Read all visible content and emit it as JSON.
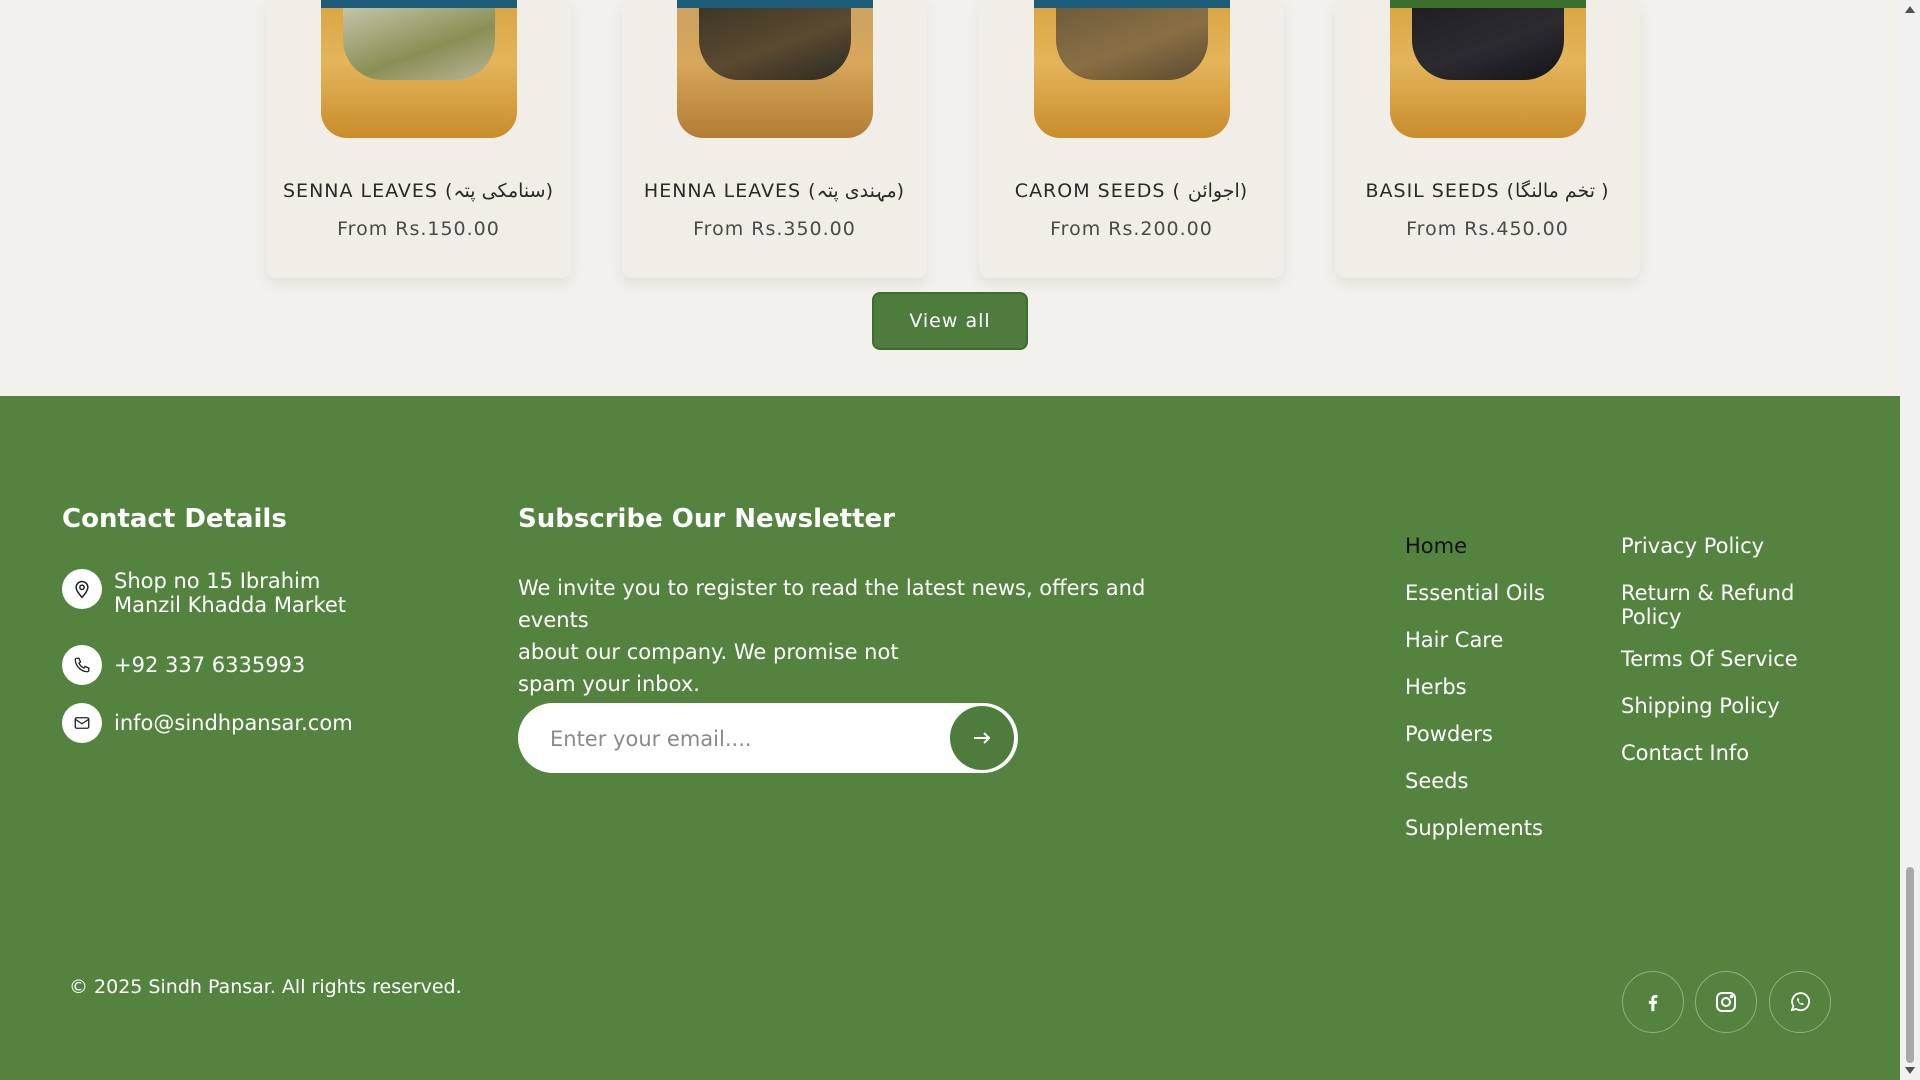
{
  "products": [
    {
      "title": "SENNA LEAVES (سنامکی پتہ)",
      "price": "From Rs.150.00"
    },
    {
      "title": "HENNA LEAVES (مہندی پتہ)",
      "price": "From Rs.350.00"
    },
    {
      "title": "CAROM SEEDS ( اجوائن)",
      "price": "From Rs.200.00"
    },
    {
      "title": "BASIL SEEDS (تخم مالنگا )",
      "price": "From Rs.450.00"
    }
  ],
  "view_all_label": "View all",
  "contact": {
    "heading": "Contact Details",
    "address_line1": "Shop no 15 Ibrahim",
    "address_line2": "Manzil Khadda Market",
    "phone": "+92 337 6335993",
    "email": "info@sindhpansar.com"
  },
  "newsletter": {
    "heading": "Subscribe Our Newsletter",
    "text_line1": "We invite you to register to read the latest news, offers and events",
    "text_line2": "about our company. We promise not",
    "text_line3": "spam your inbox.",
    "placeholder": "Enter your email...."
  },
  "nav_links": [
    "Home",
    "Essential Oils",
    "Hair Care",
    "Herbs",
    "Powders",
    "Seeds",
    "Supplements"
  ],
  "policy_links": [
    "Privacy Policy",
    "Return & Refund Policy",
    "Terms Of Service",
    "Shipping Policy",
    "Contact Info"
  ],
  "copyright": "© 2025 Sindh Pansar. All rights reserved.",
  "social": [
    "facebook-icon",
    "instagram-icon",
    "whatsapp-icon"
  ],
  "colors": {
    "footer_bg": "#54833f",
    "button_bg": "#4e7c3d",
    "page_bg": "#f2f1ec"
  }
}
